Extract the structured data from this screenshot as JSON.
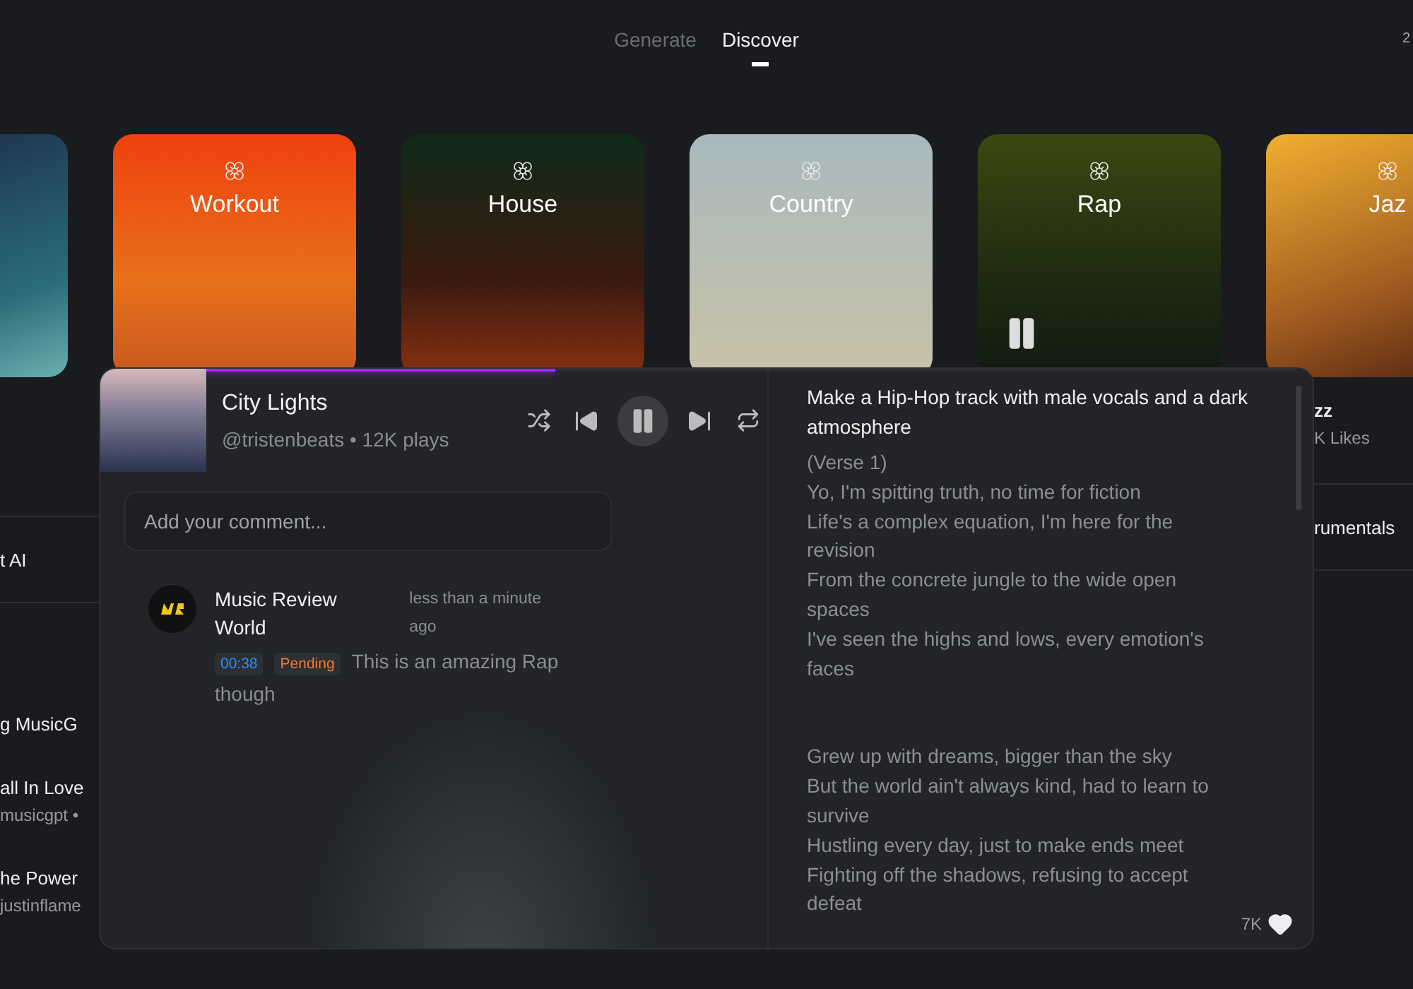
{
  "tabs": [
    {
      "label": "Generate",
      "selected": false
    },
    {
      "label": "Discover",
      "selected": true
    }
  ],
  "header_corner": "2",
  "genres": [
    {
      "title": "Workout",
      "playing": false
    },
    {
      "title": "House",
      "playing": false
    },
    {
      "title": "Country",
      "playing": false
    },
    {
      "title": "Rap",
      "playing": true
    },
    {
      "title": "Jaz",
      "playing": false
    }
  ],
  "background_left": [
    {
      "title": "t AI"
    },
    {
      "title": "g MusicG"
    },
    {
      "title": "all In Love",
      "subtitle": "musicgpt •"
    },
    {
      "title": "he Power",
      "subtitle": "justinflame"
    }
  ],
  "background_right": [
    {
      "title": "zz",
      "subtitle": "K Likes"
    },
    {
      "title": "rumentals"
    }
  ],
  "player": {
    "progress": {
      "level": 0.32
    },
    "title": "City Lights",
    "artist": "@tristenbeats",
    "separator": "•",
    "plays": "12K plays",
    "playing": true,
    "comment_input": {
      "placeholder": "Add your comment..."
    },
    "comments": [
      {
        "author": "Music Review World",
        "time": "less than a minute ago",
        "timestamp": "00:38",
        "status": "Pending",
        "text": "This is an amazing Rap though"
      }
    ],
    "prompt": "Make a Hip-Hop track with male vocals and a dark atmosphere",
    "stanzas": [
      [
        "(Verse 1)",
        "Yo, I'm spitting truth, no time for fiction",
        "Life's a complex equation, I'm here for the revision",
        "From the concrete jungle to the wide open spaces",
        "I've seen the highs and lows, every emotion's faces"
      ],
      [
        "Grew up with dreams, bigger than the sky",
        "But the world ain't always kind, had to learn to survive",
        "Hustling every day, just to make ends meet",
        "Fighting off the shadows, refusing to accept defeat"
      ]
    ],
    "likes": "7K"
  }
}
